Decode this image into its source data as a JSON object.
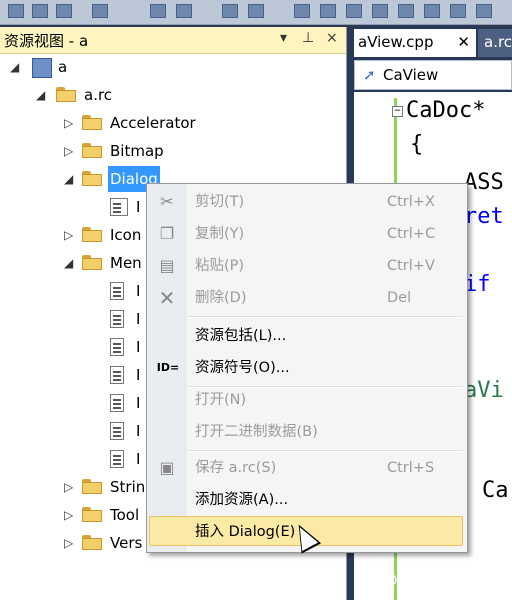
{
  "panel": {
    "title": "资源视图 - a",
    "pin": "▾ ⊥ ×"
  },
  "tree": {
    "root": "a",
    "rc": "a.rc",
    "items": [
      "Accelerator",
      "Bitmap",
      "Dialog",
      "Icon",
      "Men",
      "Strin",
      "Tool",
      "Vers"
    ],
    "dialog_child": "I",
    "menu_child_prefix": "I"
  },
  "editor": {
    "active_tab": "aView.cpp",
    "other_tab": "a.rc",
    "classbar": "CaView",
    "lines": [
      "CaDoc*",
      "{",
      "ASS",
      "ret",
      "if",
      "aVi",
      "Ca"
    ]
  },
  "menu": {
    "cut": {
      "label": "剪切(T)",
      "shortcut": "Ctrl+X"
    },
    "copy": {
      "label": "复制(Y)",
      "shortcut": "Ctrl+C"
    },
    "paste": {
      "label": "粘贴(P)",
      "shortcut": "Ctrl+V"
    },
    "delete": {
      "label": "删除(D)",
      "shortcut": "Del"
    },
    "resource_includes": {
      "label": "资源包括(L)..."
    },
    "resource_symbols": {
      "label": "资源符号(O)...",
      "icon_text": "ID="
    },
    "open": {
      "label": "打开(N)"
    },
    "open_binary": {
      "label": "打开二进制数据(B)"
    },
    "save": {
      "label": "保存 a.rc(S)",
      "shortcut": "Ctrl+S"
    },
    "add_resource": {
      "label": "添加资源(A)..."
    },
    "insert_dialog": {
      "label": "插入 Dialog(E)"
    }
  },
  "watermark": "CSDN @木小胖",
  "colors": {
    "frame": "#293955",
    "panel_header": "#fdf4bf",
    "selection": "#3399ff",
    "menu_hover": "#fbe9a6"
  }
}
